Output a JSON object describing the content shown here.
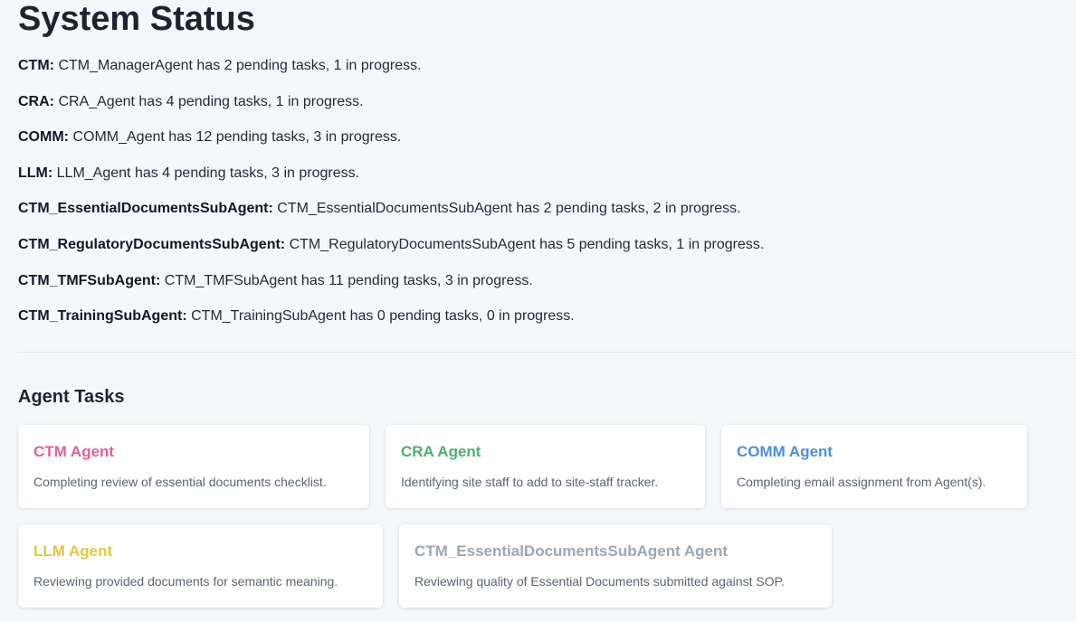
{
  "page_title": "System Status",
  "status": [
    {
      "key": "CTM:",
      "text": "CTM_ManagerAgent has 2 pending tasks, 1 in progress."
    },
    {
      "key": "CRA:",
      "text": "CRA_Agent has 4 pending tasks, 1 in progress."
    },
    {
      "key": "COMM:",
      "text": "COMM_Agent has 12 pending tasks, 3 in progress."
    },
    {
      "key": "LLM:",
      "text": "LLM_Agent has 4 pending tasks, 3 in progress."
    },
    {
      "key": "CTM_EssentialDocumentsSubAgent:",
      "text": "CTM_EssentialDocumentsSubAgent has 2 pending tasks, 2 in progress."
    },
    {
      "key": "CTM_RegulatoryDocumentsSubAgent:",
      "text": "CTM_RegulatoryDocumentsSubAgent has 5 pending tasks, 1 in progress."
    },
    {
      "key": "CTM_TMFSubAgent:",
      "text": "CTM_TMFSubAgent has 11 pending tasks, 3 in progress."
    },
    {
      "key": "CTM_TrainingSubAgent:",
      "text": "CTM_TrainingSubAgent has 0 pending tasks, 0 in progress."
    }
  ],
  "agent_tasks": {
    "heading": "Agent Tasks",
    "cards": [
      {
        "title": "CTM Agent",
        "description": "Completing review of essential documents checklist.",
        "color": "#e0609a"
      },
      {
        "title": "CRA Agent",
        "description": "Identifying site staff to add to site-staff tracker.",
        "color": "#4cb06a"
      },
      {
        "title": "COMM Agent",
        "description": "Completing email assignment from Agent(s).",
        "color": "#4a90d9"
      },
      {
        "title": "LLM Agent",
        "description": "Reviewing provided documents for semantic meaning.",
        "color": "#e6c43e"
      },
      {
        "title": "CTM_EssentialDocumentsSubAgent Agent",
        "description": "Reviewing quality of Essential Documents submitted against SOP.",
        "color": "#9aa7b8"
      }
    ]
  }
}
